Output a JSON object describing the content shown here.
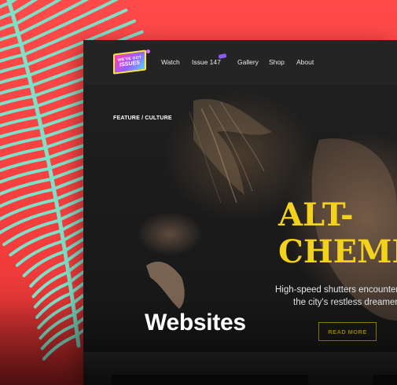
{
  "caption": "Websites",
  "site": {
    "logo": {
      "line1": "WE'VE GOT",
      "line2": "ISSUES"
    },
    "nav": [
      {
        "label": "Watch"
      },
      {
        "label": "Issue 147"
      },
      {
        "label": "Gallery"
      },
      {
        "label": "Shop"
      },
      {
        "label": "About"
      }
    ]
  },
  "hero": {
    "eyebrow": "FEATURE / CULTURE",
    "headline_line1": "ALT-",
    "headline_line2": "CHEMI",
    "subtitle_line1": "High-speed shutters encounter",
    "subtitle_line2": "the city's restless dreamer",
    "cta": "READ MORE"
  },
  "colors": {
    "background": "#ff4a4a",
    "leaf": "#7fe0c8",
    "headline": "#f3d21b",
    "cta": "#b89c13",
    "badge": "#8c5cf5"
  }
}
